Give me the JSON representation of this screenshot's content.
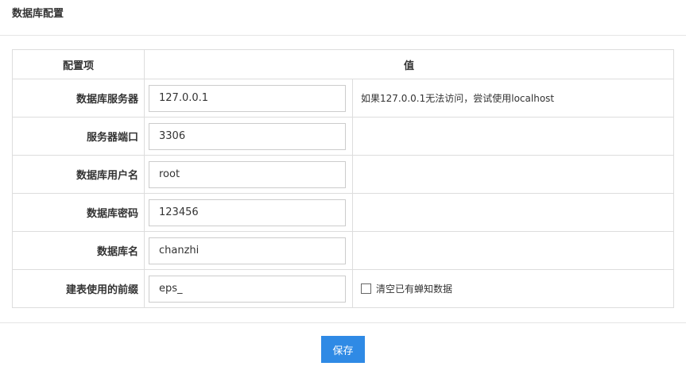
{
  "panel": {
    "title": "数据库配置"
  },
  "table": {
    "headers": {
      "item": "配置项",
      "value": "值"
    },
    "rows": [
      {
        "label": "数据库服务器",
        "value": "127.0.0.1",
        "note": "如果127.0.0.1无法访问，尝试使用localhost"
      },
      {
        "label": "服务器端口",
        "value": "3306",
        "note": ""
      },
      {
        "label": "数据库用户名",
        "value": "root",
        "note": ""
      },
      {
        "label": "数据库密码",
        "value": "123456",
        "note": ""
      },
      {
        "label": "数据库名",
        "value": "chanzhi",
        "note": ""
      },
      {
        "label": "建表使用的前缀",
        "value": "eps_",
        "checkbox_label": "清空已有蝉知数据",
        "checkbox_checked": false
      }
    ]
  },
  "footer": {
    "save_label": "保存"
  },
  "colors": {
    "primary": "#2f8ae5",
    "border": "#dddddd"
  }
}
